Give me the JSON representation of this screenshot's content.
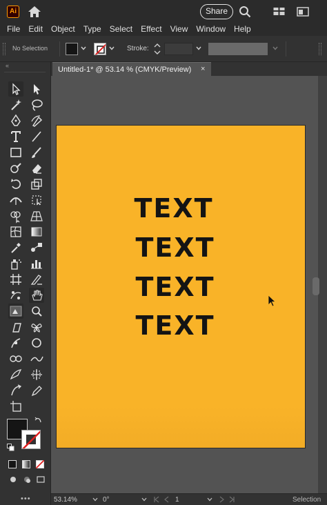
{
  "titlebar": {
    "app_logo": "Ai",
    "home_icon": "home-icon",
    "share_label": "Share",
    "search_icon": "search-icon",
    "arrange_icon": "arrange-documents-icon",
    "window_icon": "window-icon"
  },
  "menu": {
    "items": [
      "File",
      "Edit",
      "Object",
      "Type",
      "Select",
      "Effect",
      "View",
      "Window",
      "Help"
    ]
  },
  "control": {
    "selection_status": "No Selection",
    "fill_color": "#151515",
    "stroke_color": "none",
    "stroke_label": "Stroke:",
    "stroke_value": ""
  },
  "document": {
    "tab_label": "Untitled-1* @ 53.14 % (CMYK/Preview)",
    "close_glyph": "×",
    "artboard_color": "#f9b328",
    "text_lines": [
      "TEXT",
      "TEXT",
      "TEXT",
      "TEXT"
    ],
    "text_color": "#141414"
  },
  "toolbar": {
    "collapse_glyph": "«",
    "more_glyph": "•••"
  },
  "status": {
    "zoom": "53.14%",
    "rotation": "0°",
    "artboard_number": "1",
    "current_tool": "Selection"
  },
  "colors": {
    "ui_dark": "#2b2b2b",
    "panel": "#323232",
    "canvas": "#535353",
    "brand": "#ff9a00"
  }
}
